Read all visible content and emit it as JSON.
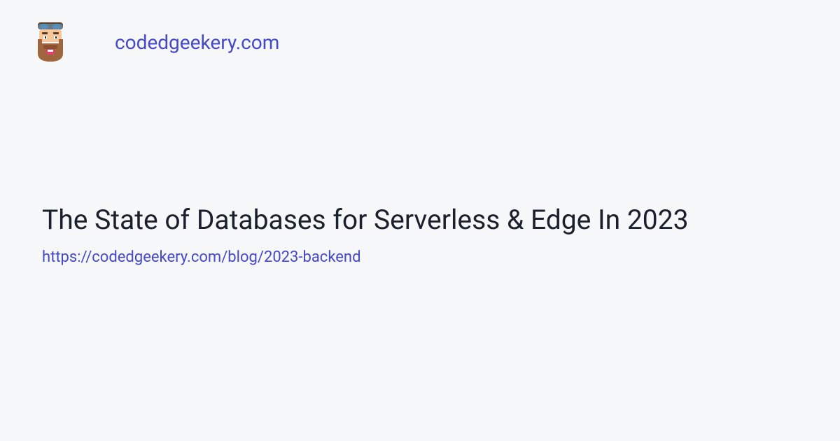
{
  "header": {
    "site_name": "codedgeekery.com"
  },
  "content": {
    "title": "The State of Databases for Serverless & Edge In 2023",
    "url": "https://codedgeekery.com/blog/2023-backend"
  }
}
